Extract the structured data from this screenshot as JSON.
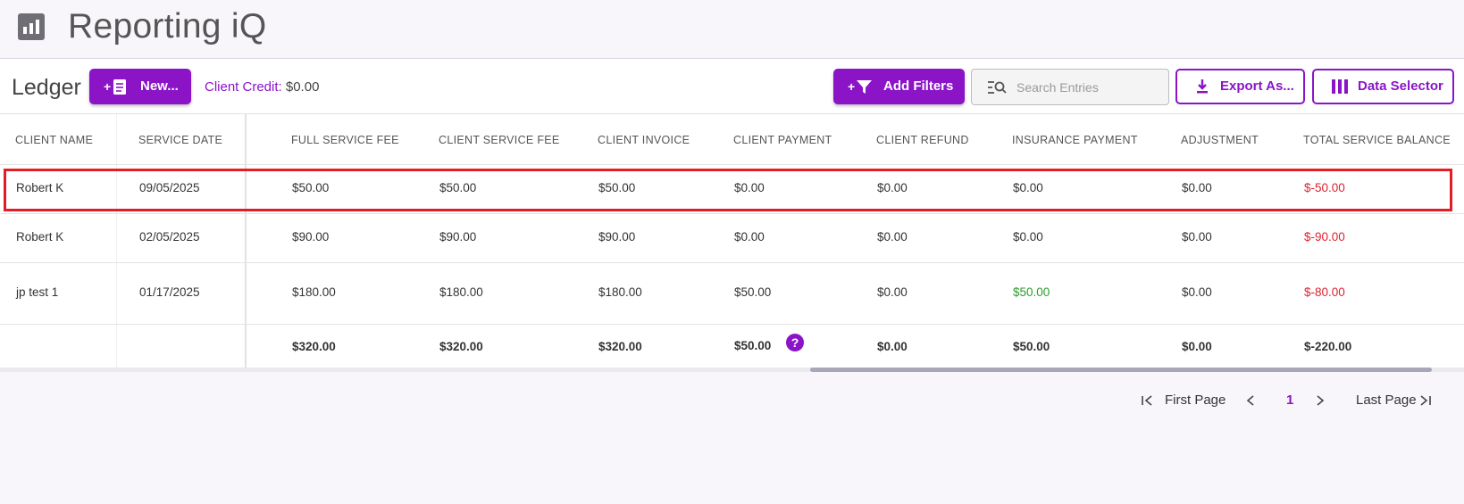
{
  "app": {
    "title": "Reporting iQ",
    "logo_icon": "bar-chart-icon"
  },
  "toolbar": {
    "title": "Ledger",
    "new_label": "New...",
    "client_credit_label": "Client Credit:",
    "client_credit_value": "$0.00",
    "add_filters_label": "Add Filters",
    "search_placeholder": "Search Entries",
    "search_value": "",
    "export_label": "Export As...",
    "data_selector_label": "Data Selector"
  },
  "table": {
    "columns": [
      "CLIENT NAME",
      "SERVICE DATE",
      "FULL SERVICE FEE",
      "CLIENT SERVICE FEE",
      "CLIENT INVOICE",
      "CLIENT PAYMENT",
      "CLIENT REFUND",
      "INSURANCE PAYMENT",
      "ADJUSTMENT",
      "TOTAL SERVICE BALANCE"
    ],
    "rows": [
      [
        "Robert K",
        "09/05/2025",
        "$50.00",
        "$50.00",
        "$50.00",
        "$0.00",
        "$0.00",
        "$0.00",
        "$0.00",
        "$-50.00"
      ],
      [
        "Robert K",
        "02/05/2025",
        "$90.00",
        "$90.00",
        "$90.00",
        "$0.00",
        "$0.00",
        "$0.00",
        "$0.00",
        "$-90.00"
      ],
      [
        "jp test 1",
        "01/17/2025",
        "$180.00",
        "$180.00",
        "$180.00",
        "$50.00",
        "$0.00",
        "$50.00",
        "$0.00",
        "$-80.00"
      ]
    ],
    "totals": [
      "",
      "",
      "$320.00",
      "$320.00",
      "$320.00",
      "$50.00",
      "$0.00",
      "$50.00",
      "$0.00",
      "$-220.00"
    ],
    "help_icon": "?"
  },
  "pagination": {
    "first_label": "First Page",
    "current_page": "1",
    "last_label": "Last Page"
  },
  "colors": {
    "accent": "#8b14c7",
    "negative": "#e0212e",
    "positive": "#2c9b2c",
    "highlight": "#e31c25"
  }
}
